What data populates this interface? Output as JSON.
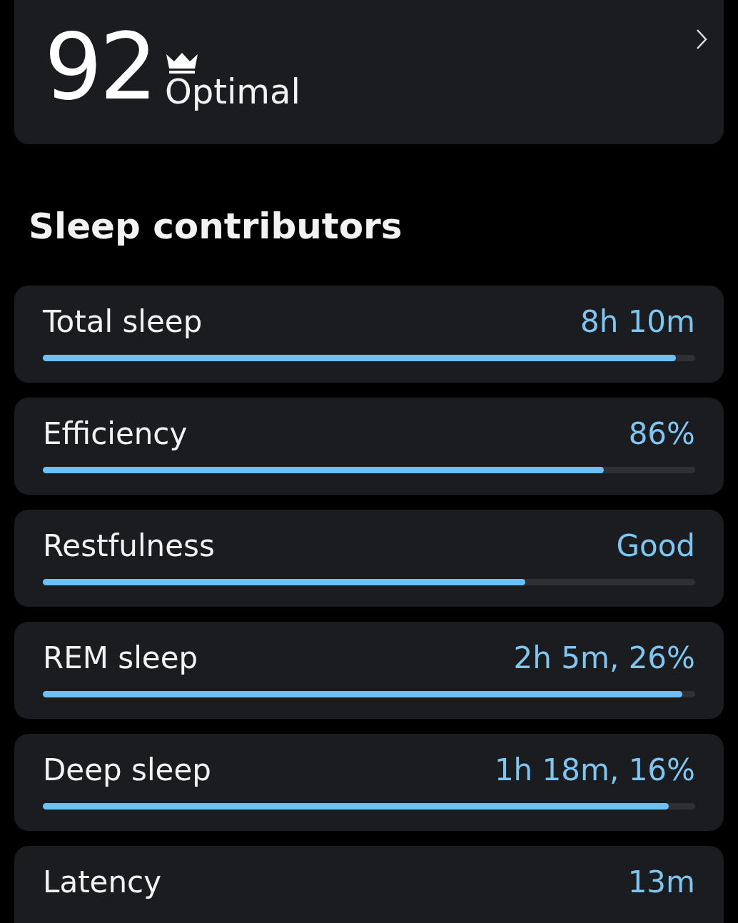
{
  "score_card": {
    "score": "92",
    "status": "Optimal"
  },
  "section_title": "Sleep contributors",
  "contributors": [
    {
      "label": "Total sleep",
      "value": "8h 10m",
      "level": 0.97
    },
    {
      "label": "Efficiency",
      "value": "86%",
      "level": 0.86
    },
    {
      "label": "Restfulness",
      "value": "Good",
      "level": 0.74
    },
    {
      "label": "REM sleep",
      "value": "2h 5m, 26%",
      "level": 0.98
    },
    {
      "label": "Deep sleep",
      "value": "1h 18m, 16%",
      "level": 0.96
    },
    {
      "label": "Latency",
      "value": "13m"
    }
  ]
}
